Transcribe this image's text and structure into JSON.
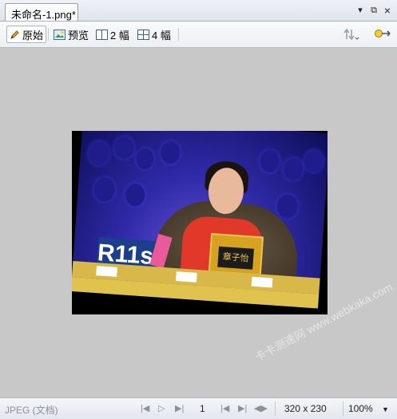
{
  "tab": {
    "title": "未命名-1.png*"
  },
  "window": {
    "pin": "▾",
    "restore": "⧉",
    "close": "×"
  },
  "toolbar": {
    "original_label": "原始",
    "preview_label": "预览",
    "two_up_label": "2 幅",
    "four_up_label": "4 幅"
  },
  "image": {
    "sign_text": "章子怡",
    "card_text": "R11s"
  },
  "watermark": "卡卡测速网 www.webkaka.com",
  "status": {
    "format": "JPEG (文档)",
    "page": "1",
    "dimensions": "320 x 230",
    "zoom": "100%"
  },
  "colors": {
    "canvas": "#c8c8c8",
    "accent_red": "#e0392a",
    "stage_blue": "#2f2aa8"
  }
}
